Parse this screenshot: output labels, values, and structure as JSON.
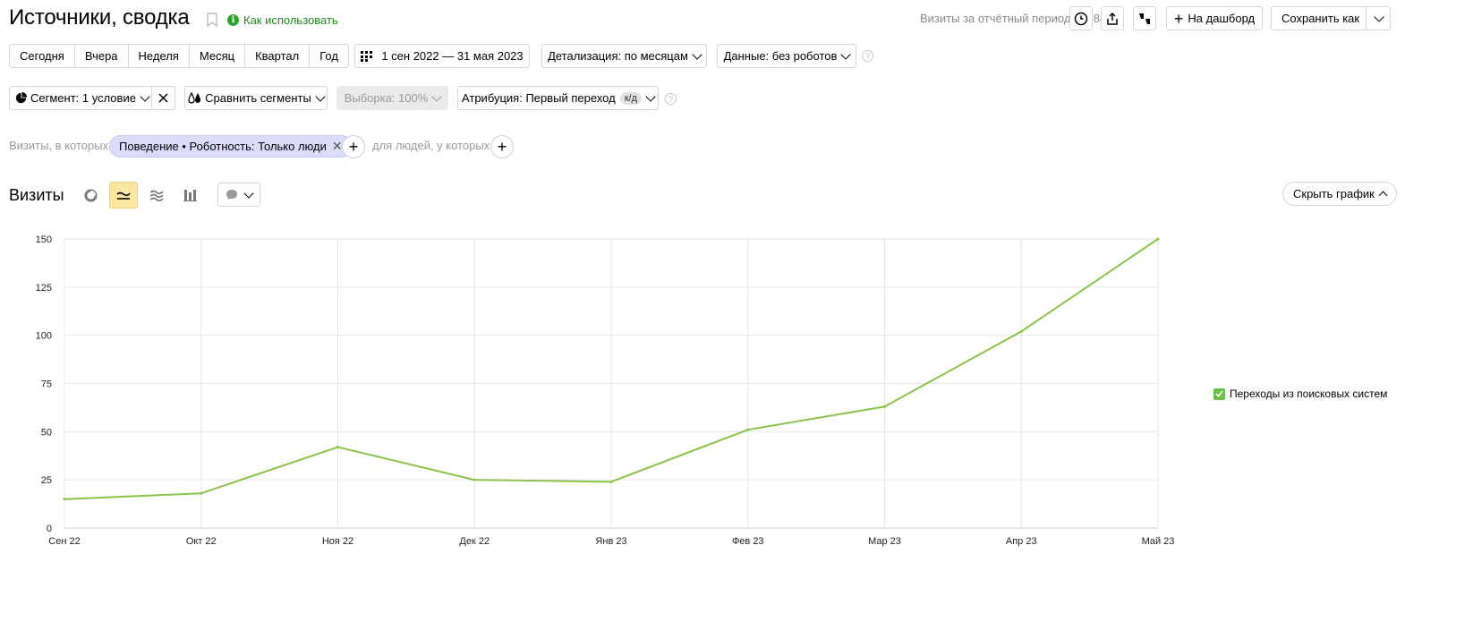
{
  "header": {
    "title": "Источники, сводка",
    "howto_label": "Как использовать",
    "visits_total": "Визиты за отчётный период: 6 788",
    "to_dashboard_label": "На дашборд",
    "save_as_label": "Сохранить как"
  },
  "period": {
    "options": [
      "Сегодня",
      "Вчера",
      "Неделя",
      "Месяц",
      "Квартал",
      "Год"
    ],
    "date_range": "1 сен 2022 — 31 мая 2023",
    "detail_label": "Детализация: по месяцам",
    "data_label": "Данные: без роботов"
  },
  "segments": {
    "segment_label": "Сегмент: 1 условие",
    "compare_label": "Сравнить сегменты",
    "sample_label": "Выборка: 100%",
    "attribution_label": "Атрибуция: Первый переход",
    "attribution_badge": "к/д"
  },
  "filters": {
    "visits_where": "Визиты, в которых",
    "chip_label": "Поведение • Роботность: Только люди",
    "people_where": "для людей, у которых"
  },
  "chart": {
    "section_title": "Визиты",
    "hide_label": "Скрыть график",
    "legend_label": "Переходы из поисковых систем",
    "line_color": "#8bc34a"
  },
  "chart_data": {
    "type": "line",
    "categories": [
      "Сен 22",
      "Окт 22",
      "Ноя 22",
      "Дек 22",
      "Янв 23",
      "Фев 23",
      "Мар 23",
      "Апр 23",
      "Май 23"
    ],
    "series": [
      {
        "name": "Переходы из поисковых систем",
        "values": [
          15,
          18,
          42,
          25,
          24,
          51,
          63,
          102,
          150
        ]
      }
    ],
    "yticks": [
      "0",
      "25",
      "50",
      "75",
      "100",
      "125",
      "150"
    ],
    "ylim": [
      0,
      150
    ],
    "grid": true,
    "legend_position": "right"
  }
}
